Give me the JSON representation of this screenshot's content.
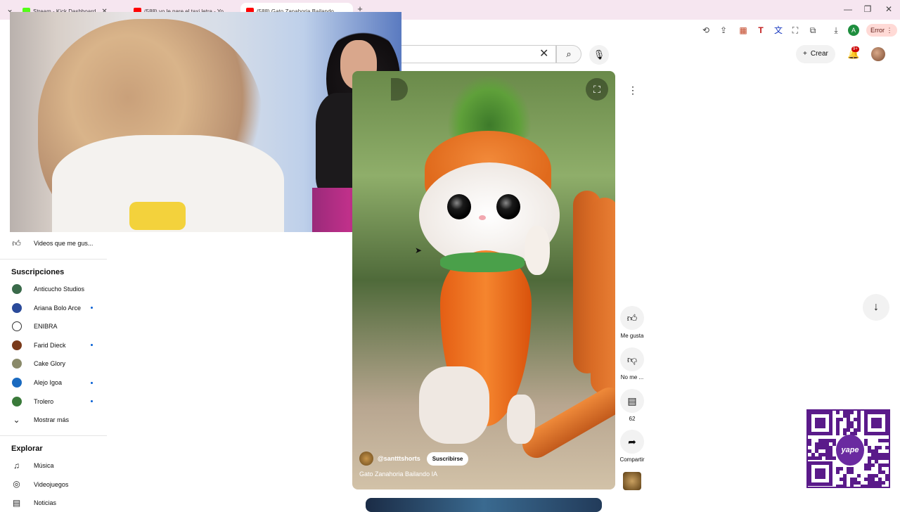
{
  "browser": {
    "tabs": [
      {
        "title": "Stream - Kick Dashboard",
        "fav_color": "#53fc18"
      },
      {
        "title": "(588) yo le pare el taxi letra - Yo...",
        "fav_color": "#ff0000"
      },
      {
        "title": "(588) Gato Zanahoria Bailando...",
        "fav_color": "#ff0000"
      }
    ],
    "new_tab": "+",
    "error_label": "Error"
  },
  "youtube": {
    "create_label": "Crear",
    "notif_count": "9+"
  },
  "sidebar": {
    "liked_label": "Videos que me gus...",
    "subs_heading": "Suscripciones",
    "subscriptions": [
      {
        "name": "Anticucho Studios",
        "color": "#3a6a4a",
        "new": false
      },
      {
        "name": "Ariana Bolo Arce",
        "color": "#2a4a9a",
        "new": true
      },
      {
        "name": "ENIBRA",
        "color": "#ffffff",
        "new": false
      },
      {
        "name": "Farid Dieck",
        "color": "#7a3a1a",
        "new": true
      },
      {
        "name": "Cake Glory",
        "color": "#8a8a6a",
        "new": false
      },
      {
        "name": "Alejo Igoa",
        "color": "#1a6ac0",
        "new": true
      },
      {
        "name": "Trolero",
        "color": "#3a7a3a",
        "new": true
      }
    ],
    "show_more": "Mostrar más",
    "explore_heading": "Explorar",
    "explore": [
      {
        "name": "Música",
        "icon": "music-note-icon",
        "glyph": "♫"
      },
      {
        "name": "Videojuegos",
        "icon": "gamepad-icon",
        "glyph": "◎"
      },
      {
        "name": "Noticias",
        "icon": "newspaper-icon",
        "glyph": "▤"
      }
    ]
  },
  "short": {
    "channel": "@santttshorts",
    "subscribe": "Suscribirse",
    "title": "Gato Zanahoria Bailando IA"
  },
  "actions": {
    "like_label": "Me gusta",
    "dislike_label": "No me ...",
    "comments_count": "62",
    "share_label": "Compartir"
  },
  "qr": {
    "brand": "yape"
  }
}
